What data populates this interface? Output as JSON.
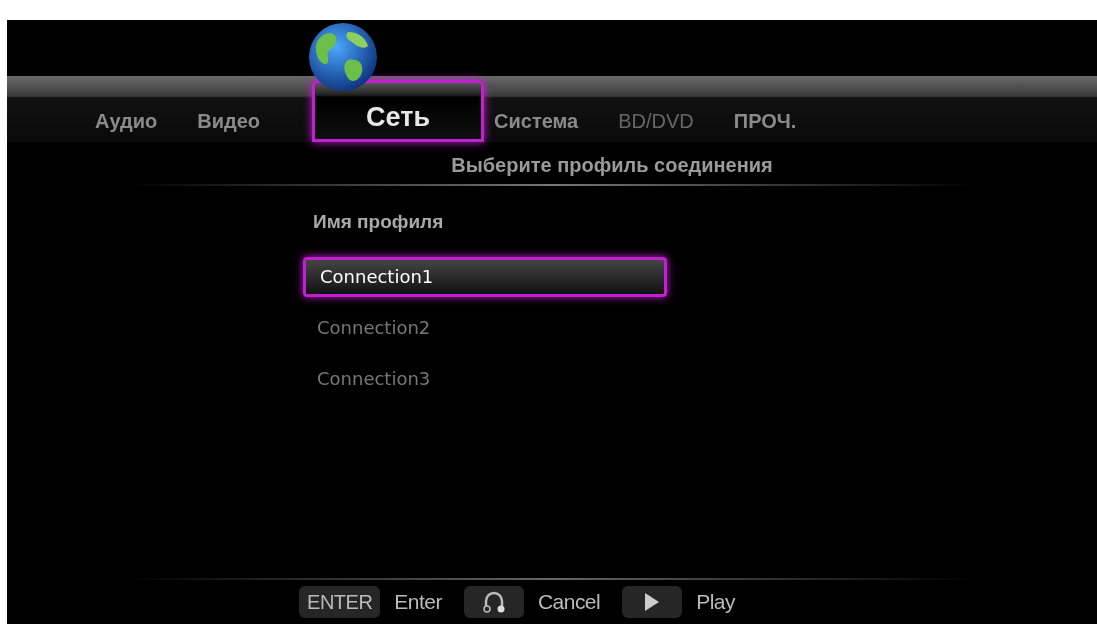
{
  "tabs": [
    {
      "label": "Аудио",
      "selected": false,
      "disabled": false
    },
    {
      "label": "Видео",
      "selected": false,
      "disabled": false
    },
    {
      "label": "Сеть",
      "selected": true,
      "disabled": false
    },
    {
      "label": "Система",
      "selected": false,
      "disabled": false
    },
    {
      "label": "BD/DVD",
      "selected": false,
      "disabled": true
    },
    {
      "label": "ПРОЧ.",
      "selected": false,
      "disabled": false
    }
  ],
  "subtitle": "Выберите профиль соединения",
  "list_heading": "Имя профиля",
  "profiles": [
    {
      "label": "Connection1",
      "selected": true
    },
    {
      "label": "Connection2",
      "selected": false
    },
    {
      "label": "Connection3",
      "selected": false
    }
  ],
  "hints": [
    {
      "kind": "text",
      "key": "ENTER",
      "label": "Enter"
    },
    {
      "kind": "headset",
      "label": "Cancel"
    },
    {
      "kind": "play",
      "label": "Play"
    }
  ]
}
